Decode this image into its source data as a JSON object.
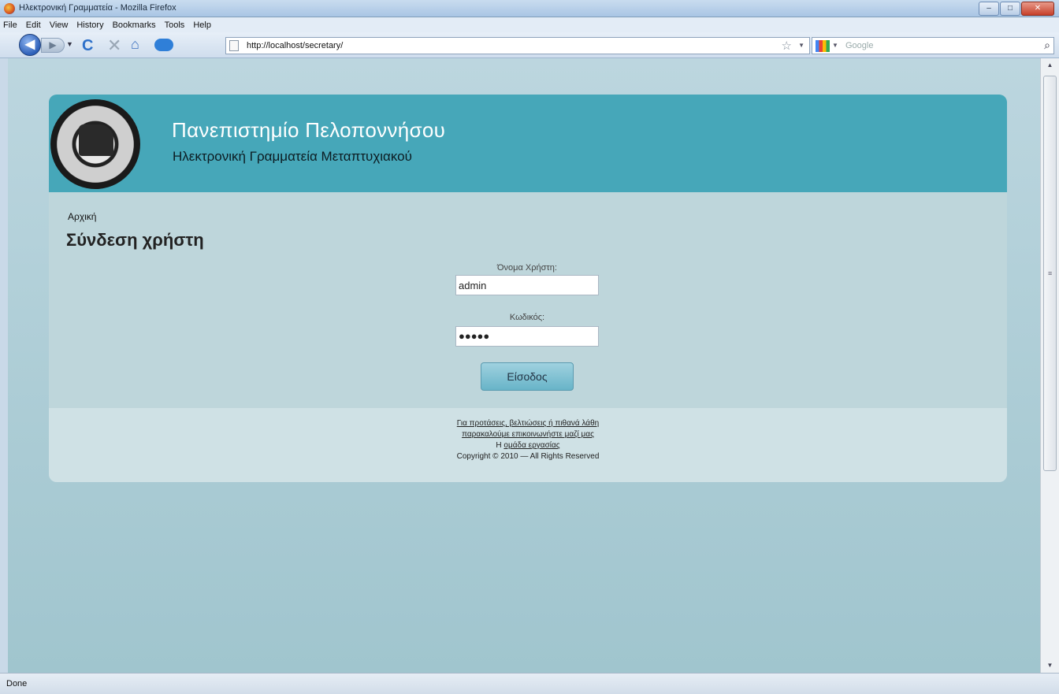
{
  "window": {
    "title": "Ηλεκτρονική Γραμματεία - Mozilla Firefox",
    "buttons": {
      "minimize": "–",
      "maximize": "□",
      "close": "✕"
    }
  },
  "menubar": {
    "items": [
      {
        "label": "File"
      },
      {
        "label": "Edit"
      },
      {
        "label": "View"
      },
      {
        "label": "History"
      },
      {
        "label": "Bookmarks"
      },
      {
        "label": "Tools"
      },
      {
        "label": "Help"
      }
    ]
  },
  "navbar": {
    "url": "http://localhost/secretary/",
    "search_placeholder": "Google",
    "icons": {
      "back": "◀",
      "forward": "▶",
      "history_drop": "▼",
      "reload": "C",
      "stop": "✕",
      "home": "⌂",
      "star": "☆",
      "drop": "▼",
      "search": "⌕"
    }
  },
  "header": {
    "title": "Πανεπιστημίο Πελοποννήσου",
    "subtitle": "Ηλεκτρονική Γραμματεία Μεταπτυχιακού"
  },
  "breadcrumb": "Αρχική",
  "login": {
    "heading": "Σύνδεση χρήστη",
    "username_label": "Όνομα Χρήστη:",
    "username_value": "admin",
    "password_label": "Κωδικός:",
    "password_value": "●●●●●",
    "submit_label": "Είσοδος"
  },
  "footer": {
    "line1": "Για προτάσεις, βελτιώσεις ή πιθανά λάθη",
    "line2": "παρακαλούμε επικοινωνήστε μαζί μας",
    "line3_prefix": "Η ",
    "line3_link": "ομάδα εργασίας",
    "copyright": "Copyright © 2010 — All Rights Reserved"
  },
  "statusbar": {
    "text": "Done"
  },
  "scrollbar": {
    "up": "▲",
    "down": "▼",
    "grip": "≡"
  }
}
